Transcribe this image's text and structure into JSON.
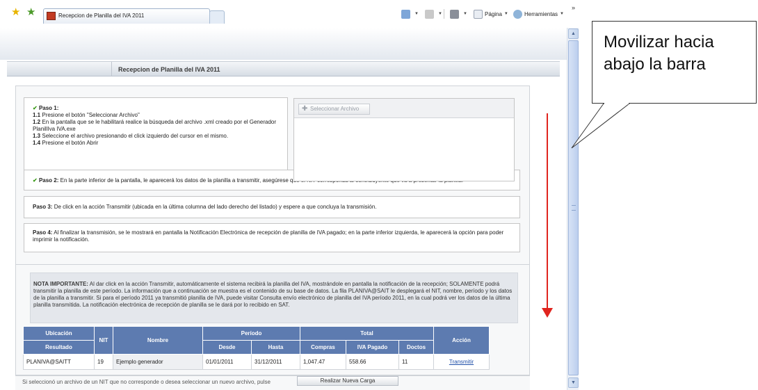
{
  "browser": {
    "tab_title": "Recepcion de Planilla del IVA 2011",
    "toolbar": {
      "page_label": "Página",
      "tools_label": "Herramientas",
      "overflow": "»"
    }
  },
  "page": {
    "title": "Recepcion de Planilla del IVA 2011",
    "paso1": {
      "heading": "Paso 1:",
      "lines": [
        {
          "num": "1.1",
          "text": "Presione el botón \"Seleccionar Archivo\""
        },
        {
          "num": "1.2",
          "text": "En la pantalla que se le habilitará realice la búsqueda del archivo .xml creado por el Generador PlanillIva IVA.exe"
        },
        {
          "num": "1.3",
          "text": "Seleccione el archivo presionando el click izquierdo del cursor en el mismo."
        },
        {
          "num": "1.4",
          "text": "Presione el botón Abrir"
        }
      ]
    },
    "select_button": "Seleccionar Archivo",
    "paso2": {
      "label": "Paso 2:",
      "text": "En la parte inferior de la pantalla, le aparecerá los datos de la planilla a transmitir, asegúrese que el NIT corresponda al contribuyente que va a presentar la planilla."
    },
    "paso3": {
      "label": "Paso 3:",
      "text": "De click en la acción Transmitir (ubicada en la última columna del lado derecho del listado) y espere a que concluya la transmisión."
    },
    "paso4": {
      "label": "Paso 4:",
      "text": "Al finalizar la transmisión, se le mostrará en pantalla la Notificación Electrónica de recepción de planilla de IVA pagado; en la parte inferior izquierda, le aparecerá la opción para poder imprimir la notificación."
    },
    "nota": {
      "label": "NOTA IMPORTANTE:",
      "text": "Al dar click en la acción Transmitir, automáticamente el sistema recibirá la planilla del IVA, mostrándole en pantalla la notificación de la recepción; SOLAMENTE podrá transmitir la planilla de este período. La información que a continuación se muestra es el contenido de su base de datos. La fila PLANIVA@SAIT le desplegará el NIT, nombre, período y los datos de la planilla a transmitir. Si para el período 2011 ya transmitió planilla de IVA, puede visitar Consulta envío electrónico de planilla del IVA período 2011, en la cual podrá ver los datos de la última planilla transmitida. La notificación electrónica de recepción de planilla se le dará por lo recibido en SAT."
    },
    "table": {
      "headers": {
        "ubicacion": "Ubicación",
        "resultado": "Resultado",
        "nit": "NIT",
        "nombre": "Nombre",
        "periodo": "Período",
        "desde": "Desde",
        "hasta": "Hasta",
        "total": "Total",
        "compras": "Compras",
        "iva_pagado": "IVA Pagado",
        "doctos": "Doctos",
        "accion": "Acción"
      },
      "row": {
        "resultado": "PLANIVA@SAITT",
        "nit": "19",
        "nombre": "Ejemplo generador",
        "desde": "01/01/2011",
        "hasta": "31/12/2011",
        "compras": "1,047.47",
        "iva_pagado": "558.66",
        "doctos": "11",
        "accion": "Transmitir"
      }
    },
    "bottom": {
      "text": "Si seleccionó un archivo de un NIT que no corresponde o desea seleccionar un nuevo archivo, pulse",
      "button": "Realizar Nueva Carga"
    }
  },
  "annotation": {
    "callout_text": "Movilizar hacia abajo la barra",
    "arrow_color": "#e0241e"
  }
}
